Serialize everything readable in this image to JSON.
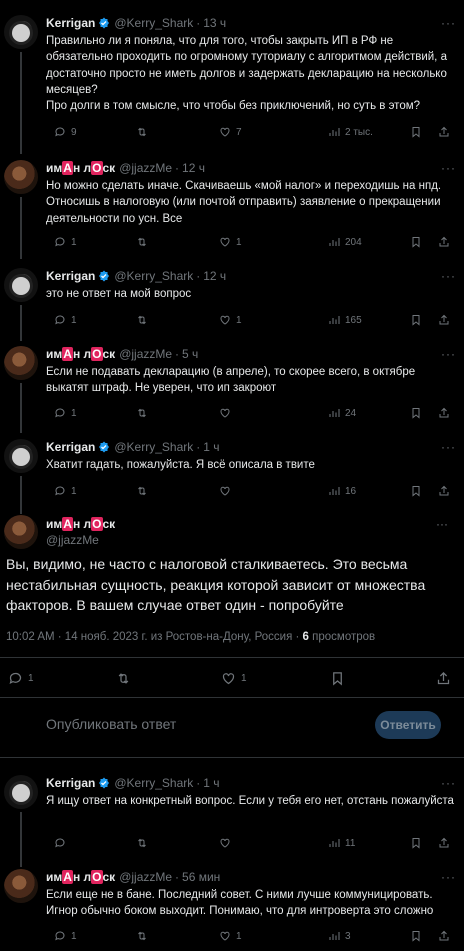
{
  "tweets": [
    {
      "name": "Kerrigan",
      "handle": "@Kerry_Shark",
      "time": "13 ч",
      "text": "Правильно ли я поняла, что для того, чтобы закрыть ИП в РФ не обязательно проходить по огромному туториалу с алгоритмом действий, а достаточно просто не иметь долгов и задержать декларацию на несколько месяцев?\nПро долги в том смысле, что чтобы без приключений, но суть в этом?",
      "replies": "9",
      "likes": "7",
      "views": "2 тыс."
    },
    {
      "name_parts": [
        "им",
        "А",
        "н л",
        "О",
        "ск"
      ],
      "handle": "@jjazzMe",
      "time": "12 ч",
      "text": "Но можно сделать иначе. Скачиваешь «мой налог» и переходишь на нпд. Относишь в налоговую (или почтой отправить) заявление о прекращении деятельности по усн. Все",
      "replies": "1",
      "likes": "1",
      "views": "204"
    },
    {
      "name": "Kerrigan",
      "handle": "@Kerry_Shark",
      "time": "12 ч",
      "text": "это не ответ на мой вопрос",
      "replies": "1",
      "likes": "1",
      "views": "165"
    },
    {
      "name_parts": [
        "им",
        "А",
        "н л",
        "О",
        "ск"
      ],
      "handle": "@jjazzMe",
      "time": "5 ч",
      "text": "Если не подавать декларацию (в апреле), то скорее всего, в октябре выкатят штраф. Не уверен, что ип закроют",
      "replies": "1",
      "likes": "",
      "views": "24"
    },
    {
      "name": "Kerrigan",
      "handle": "@Kerry_Shark",
      "time": "1 ч",
      "text": "Хватит гадать, пожалуйста. Я всё описала в твите",
      "replies": "1",
      "likes": "",
      "views": "16"
    }
  ],
  "main": {
    "name_parts": [
      "им",
      "А",
      "н л",
      "О",
      "ск"
    ],
    "handle": "@jjazzMe",
    "text": "Вы, видимо, не часто с налоговой сталкиваетесь. Это весьма нестабильная сущность, реакция которой зависит от множества факторов. В вашем случае ответ один - попробуйте",
    "meta_time": "10:02 AM · 14 нояб. 2023 г. из Ростов-на-Дону, Россия · ",
    "views_count": "6",
    "views_label": " просмотров",
    "replies": "1",
    "likes": "1"
  },
  "reply_box": {
    "placeholder": "Опубликовать ответ",
    "button": "Ответить"
  },
  "bottom_tweets": [
    {
      "name": "Kerrigan",
      "handle": "@Kerry_Shark",
      "time": "1 ч",
      "text": "Я ищу ответ на конкретный вопрос. Если у тебя его нет, отстань пожалуйста",
      "replies": "",
      "likes": "",
      "views": "11"
    },
    {
      "name_parts": [
        "им",
        "А",
        "н л",
        "О",
        "ск"
      ],
      "handle": "@jjazzMe",
      "time": "56 мин",
      "text": "Если еще не в бане. Последний совет. С ними лучше коммуницировать. Игнор обычно боком выходит. Понимаю, что для интроверта это сложно",
      "replies": "1",
      "likes": "1",
      "views": "3"
    }
  ],
  "icons": [
    "reply-icon",
    "retweet-icon",
    "like-icon",
    "views-icon",
    "bookmark-icon",
    "share-icon",
    "more-icon",
    "verified-icon"
  ],
  "colors": {
    "accent": "#1d9bf0",
    "muted": "#71767b",
    "red_box": "#e0245e"
  }
}
